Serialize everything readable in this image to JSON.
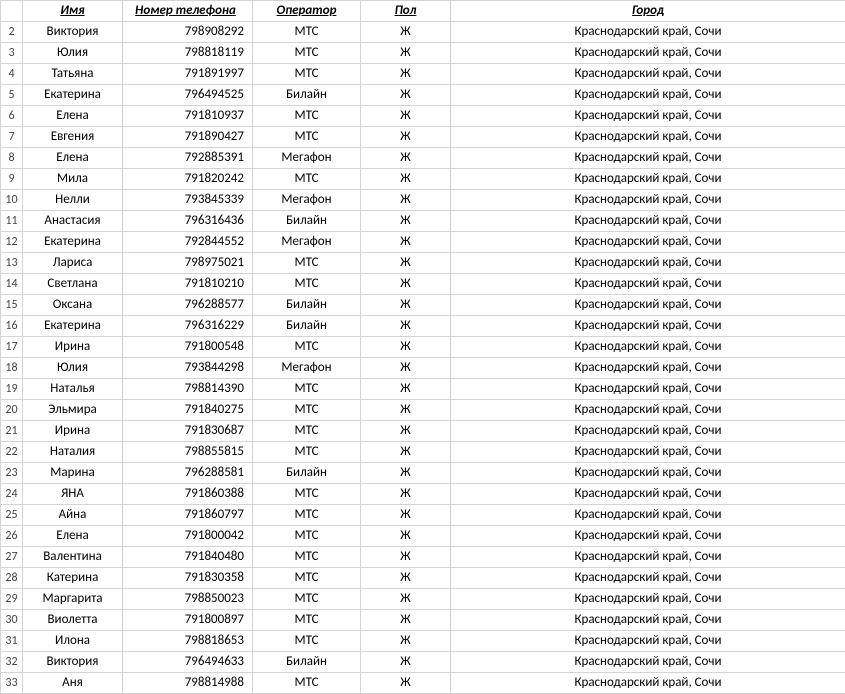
{
  "headers": {
    "name": "Имя",
    "phone": "Номер телефона",
    "operator": "Оператор",
    "gender": "Пол",
    "city": "Город"
  },
  "rowStart": 2,
  "rows": [
    {
      "name": "Виктория",
      "phone": "798908292",
      "operator": "МТС",
      "gender": "Ж",
      "city": "Краснодарский край, Сочи"
    },
    {
      "name": "Юлия",
      "phone": "798818119",
      "operator": "МТС",
      "gender": "Ж",
      "city": "Краснодарский край, Сочи"
    },
    {
      "name": "Татьяна",
      "phone": "791891997",
      "operator": "МТС",
      "gender": "Ж",
      "city": "Краснодарский край, Сочи"
    },
    {
      "name": "Екатерина",
      "phone": "796494525",
      "operator": "Билайн",
      "gender": "Ж",
      "city": "Краснодарский край, Сочи"
    },
    {
      "name": "Елена",
      "phone": "791810937",
      "operator": "МТС",
      "gender": "Ж",
      "city": "Краснодарский край, Сочи"
    },
    {
      "name": "Евгения",
      "phone": "791890427",
      "operator": "МТС",
      "gender": "Ж",
      "city": "Краснодарский край, Сочи"
    },
    {
      "name": "Елена",
      "phone": "792885391",
      "operator": "Мегафон",
      "gender": "Ж",
      "city": "Краснодарский край, Сочи"
    },
    {
      "name": "Мила",
      "phone": "791820242",
      "operator": "МТС",
      "gender": "Ж",
      "city": "Краснодарский край, Сочи"
    },
    {
      "name": "Нелли",
      "phone": "793845339",
      "operator": "Мегафон",
      "gender": "Ж",
      "city": "Краснодарский край, Сочи"
    },
    {
      "name": "Анастасия",
      "phone": "796316436",
      "operator": "Билайн",
      "gender": "Ж",
      "city": "Краснодарский край, Сочи"
    },
    {
      "name": "Екатерина",
      "phone": "792844552",
      "operator": "Мегафон",
      "gender": "Ж",
      "city": "Краснодарский край, Сочи"
    },
    {
      "name": "Лариса",
      "phone": "798975021",
      "operator": "МТС",
      "gender": "Ж",
      "city": "Краснодарский край, Сочи"
    },
    {
      "name": "Светлана",
      "phone": "791810210",
      "operator": "МТС",
      "gender": "Ж",
      "city": "Краснодарский край, Сочи"
    },
    {
      "name": "Оксана",
      "phone": "796288577",
      "operator": "Билайн",
      "gender": "Ж",
      "city": "Краснодарский край, Сочи"
    },
    {
      "name": "Екатерина",
      "phone": "796316229",
      "operator": "Билайн",
      "gender": "Ж",
      "city": "Краснодарский край, Сочи"
    },
    {
      "name": "Ирина",
      "phone": "791800548",
      "operator": "МТС",
      "gender": "Ж",
      "city": "Краснодарский край, Сочи"
    },
    {
      "name": "Юлия",
      "phone": "793844298",
      "operator": "Мегафон",
      "gender": "Ж",
      "city": "Краснодарский край, Сочи"
    },
    {
      "name": "Наталья",
      "phone": "798814390",
      "operator": "МТС",
      "gender": "Ж",
      "city": "Краснодарский край, Сочи"
    },
    {
      "name": "Эльмира",
      "phone": "791840275",
      "operator": "МТС",
      "gender": "Ж",
      "city": "Краснодарский край, Сочи"
    },
    {
      "name": "Ирина",
      "phone": "791830687",
      "operator": "МТС",
      "gender": "Ж",
      "city": "Краснодарский край, Сочи"
    },
    {
      "name": "Наталия",
      "phone": "798855815",
      "operator": "МТС",
      "gender": "Ж",
      "city": "Краснодарский край, Сочи"
    },
    {
      "name": "Марина",
      "phone": "796288581",
      "operator": "Билайн",
      "gender": "Ж",
      "city": "Краснодарский край, Сочи"
    },
    {
      "name": "ЯНА",
      "phone": "791860388",
      "operator": "МТС",
      "gender": "Ж",
      "city": "Краснодарский край, Сочи"
    },
    {
      "name": "Айна",
      "phone": "791860797",
      "operator": "МТС",
      "gender": "Ж",
      "city": "Краснодарский край, Сочи"
    },
    {
      "name": "Елена",
      "phone": "791800042",
      "operator": "МТС",
      "gender": "Ж",
      "city": "Краснодарский край, Сочи"
    },
    {
      "name": "Валентина",
      "phone": "791840480",
      "operator": "МТС",
      "gender": "Ж",
      "city": "Краснодарский край, Сочи"
    },
    {
      "name": "Катерина",
      "phone": "791830358",
      "operator": "МТС",
      "gender": "Ж",
      "city": "Краснодарский край, Сочи"
    },
    {
      "name": "Маргарита",
      "phone": "798850023",
      "operator": "МТС",
      "gender": "Ж",
      "city": "Краснодарский край, Сочи"
    },
    {
      "name": "Виолетта",
      "phone": "791800897",
      "operator": "МТС",
      "gender": "Ж",
      "city": "Краснодарский край, Сочи"
    },
    {
      "name": "Илона",
      "phone": "798818653",
      "operator": "МТС",
      "gender": "Ж",
      "city": "Краснодарский край, Сочи"
    },
    {
      "name": "Виктория",
      "phone": "796494633",
      "operator": "Билайн",
      "gender": "Ж",
      "city": "Краснодарский край, Сочи"
    },
    {
      "name": "Аня",
      "phone": "798814988",
      "operator": "МТС",
      "gender": "Ж",
      "city": "Краснодарский край, Сочи"
    }
  ]
}
